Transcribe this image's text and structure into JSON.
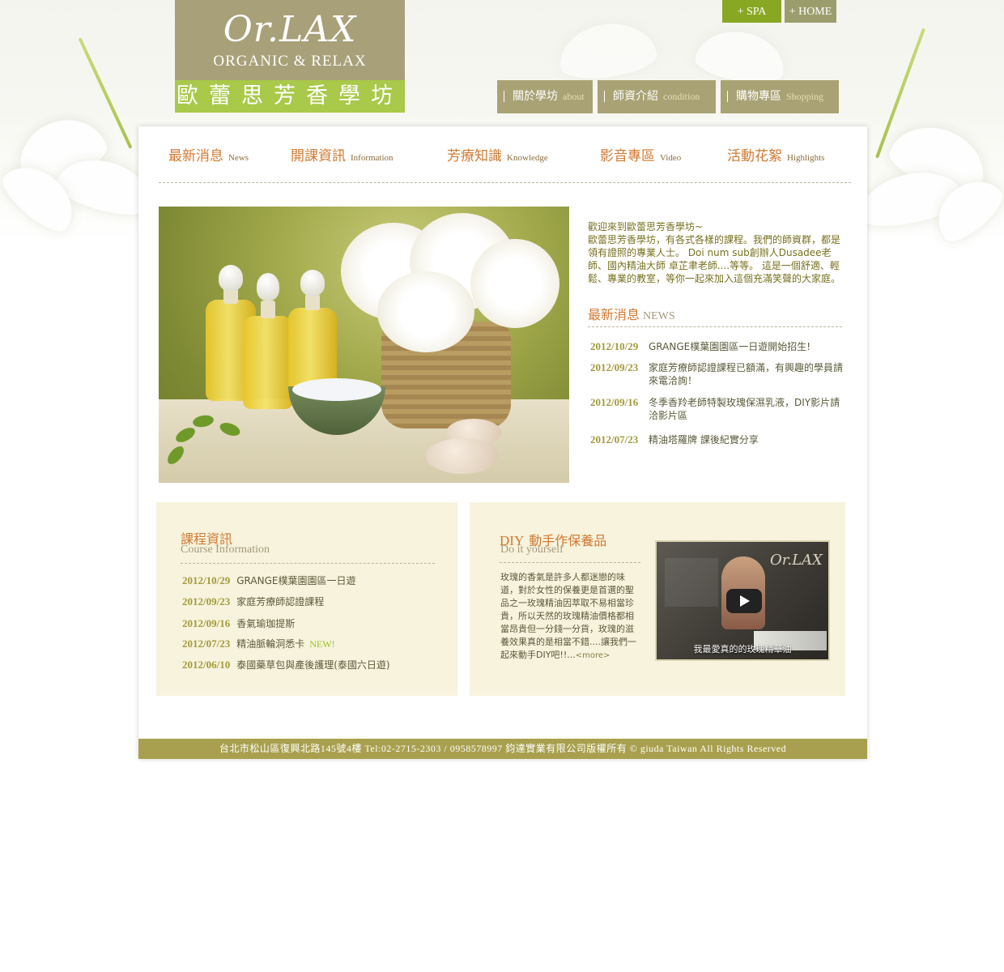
{
  "brand": {
    "logo_mark": "Or.LAX",
    "logo_subtitle": "ORGANIC & RELAX",
    "school_name": "歐蕾思芳香學坊"
  },
  "top_links": [
    {
      "label": "+ SPA"
    },
    {
      "label": "+ HOME"
    }
  ],
  "main_nav": [
    {
      "label": "關於學坊",
      "en": "about"
    },
    {
      "label": "師資介紹",
      "en": "condition"
    },
    {
      "label": "購物專區",
      "en": "Shopping"
    }
  ],
  "sub_nav": [
    {
      "label": "最新消息",
      "en": "News"
    },
    {
      "label": "開課資訊",
      "en": "Information"
    },
    {
      "label": "芳療知識",
      "en": "Knowledge"
    },
    {
      "label": "影音專區",
      "en": "Video"
    },
    {
      "label": "活動花絮",
      "en": "Highlights"
    }
  ],
  "intro": {
    "greeting": "歡迎來到歐蕾思芳香學坊~",
    "body": "歐蕾思芳香學坊，有各式各樣的課程。我們的師資群，都是領有證照的專業人士。 Doi num sub創辦人Dusadee老師、國內精油大師 卓芷聿老師....等等。 這是一個舒適、輕鬆、專業的教室，等你一起來加入這個充滿笑聲的大家庭。"
  },
  "news": {
    "title": "最新消息",
    "title_en": "NEWS",
    "items": [
      {
        "date": "2012/10/29",
        "text": "GRANGE樸葉園園區一日遊開始招生!"
      },
      {
        "date": "2012/09/23",
        "text": "家庭芳療師認證課程已額滿，有興趣的學員請來電洽詢！"
      },
      {
        "date": "2012/09/16",
        "text": "冬季香羚老師特製玫瑰保濕乳液，DIY影片請洽影片區"
      },
      {
        "date": "2012/07/23",
        "text": "精油塔羅牌 課後紀實分享"
      }
    ]
  },
  "course": {
    "title": "課程資訊",
    "title_en": "Course Information",
    "new_badge": "NEW!",
    "items": [
      {
        "date": "2012/10/29",
        "text": "GRANGE樸葉園園區一日遊"
      },
      {
        "date": "2012/09/23",
        "text": "家庭芳療師認證課程"
      },
      {
        "date": "2012/09/16",
        "text": "香氣瑜珈提斯"
      },
      {
        "date": "2012/07/23",
        "text": "精油脈輪洞悉卡"
      },
      {
        "date": "2012/06/10",
        "text": "泰國藥草包與產後護理(泰國六日遊)"
      }
    ]
  },
  "diy": {
    "title_prefix": "DIY",
    "title": "動手作保養品",
    "title_en": "Do it yourself",
    "body": "玫瑰的香氣是許多人都迷戀的味道，對於女性的保養更是首選的聖品之一玫瑰精油因萃取不易相當珍貴，所以天然的玫瑰精油價格都相當昂貴但一分錢一分貨，玫瑰的滋養效果真的是相當不錯....讓我們一起來動手DIY吧!!...",
    "more": "<more>",
    "video_watermark": "Or.LAX",
    "video_caption": "我最愛真的的玫瑰精華油"
  },
  "footer": {
    "text": "台北市松山區復興北路145號4樓 Tel:02-2715-2303 / 0958578997 鈞達實業有限公司版權所有 © giuda Taiwan All Rights Reserved"
  },
  "colors": {
    "accent_orange": "#d07a32",
    "olive": "#a8a04e",
    "khaki": "#a8a078",
    "lime": "#a9c94a",
    "panel_bg": "#f7f3dd"
  }
}
